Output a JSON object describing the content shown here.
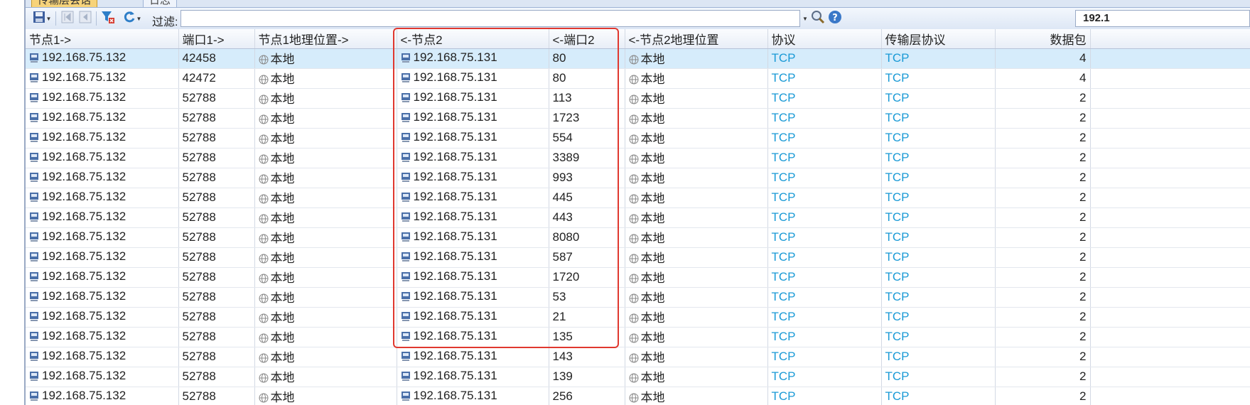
{
  "tabs": [
    {
      "label": "传输层会话",
      "active": true
    },
    {
      "label": "日志",
      "active": false
    }
  ],
  "toolbar": {
    "filter_label": "过滤:",
    "filter_value": "",
    "address_value": "192.1"
  },
  "icons": {
    "save": "save-icon",
    "first": "first-page-icon",
    "prev": "previous-page-icon",
    "filter": "filter-icon",
    "refresh": "refresh-icon",
    "search": "search-icon",
    "help": "help-icon",
    "host": "host-icon",
    "globe": "globe-icon"
  },
  "colors": {
    "link": "#1a9ad6",
    "selection": "#d6ecfb",
    "highlight": "#e0382f",
    "active_tab": "#f7d37a"
  },
  "table": {
    "columns": [
      "节点1->",
      "端口1->",
      "节点1地理位置->",
      "<-节点2",
      "<-端口2",
      "<-节点2地理位置",
      "协议",
      "传输层协议",
      "数据包"
    ],
    "rows": [
      {
        "node1": "192.168.75.132",
        "port1": "42458",
        "geo1": "本地",
        "node2": "192.168.75.131",
        "port2": "80",
        "geo2": "本地",
        "proto": "TCP",
        "transport": "TCP",
        "packets": "4"
      },
      {
        "node1": "192.168.75.132",
        "port1": "42472",
        "geo1": "本地",
        "node2": "192.168.75.131",
        "port2": "80",
        "geo2": "本地",
        "proto": "TCP",
        "transport": "TCP",
        "packets": "4"
      },
      {
        "node1": "192.168.75.132",
        "port1": "52788",
        "geo1": "本地",
        "node2": "192.168.75.131",
        "port2": "113",
        "geo2": "本地",
        "proto": "TCP",
        "transport": "TCP",
        "packets": "2"
      },
      {
        "node1": "192.168.75.132",
        "port1": "52788",
        "geo1": "本地",
        "node2": "192.168.75.131",
        "port2": "1723",
        "geo2": "本地",
        "proto": "TCP",
        "transport": "TCP",
        "packets": "2"
      },
      {
        "node1": "192.168.75.132",
        "port1": "52788",
        "geo1": "本地",
        "node2": "192.168.75.131",
        "port2": "554",
        "geo2": "本地",
        "proto": "TCP",
        "transport": "TCP",
        "packets": "2"
      },
      {
        "node1": "192.168.75.132",
        "port1": "52788",
        "geo1": "本地",
        "node2": "192.168.75.131",
        "port2": "3389",
        "geo2": "本地",
        "proto": "TCP",
        "transport": "TCP",
        "packets": "2"
      },
      {
        "node1": "192.168.75.132",
        "port1": "52788",
        "geo1": "本地",
        "node2": "192.168.75.131",
        "port2": "993",
        "geo2": "本地",
        "proto": "TCP",
        "transport": "TCP",
        "packets": "2"
      },
      {
        "node1": "192.168.75.132",
        "port1": "52788",
        "geo1": "本地",
        "node2": "192.168.75.131",
        "port2": "445",
        "geo2": "本地",
        "proto": "TCP",
        "transport": "TCP",
        "packets": "2"
      },
      {
        "node1": "192.168.75.132",
        "port1": "52788",
        "geo1": "本地",
        "node2": "192.168.75.131",
        "port2": "443",
        "geo2": "本地",
        "proto": "TCP",
        "transport": "TCP",
        "packets": "2"
      },
      {
        "node1": "192.168.75.132",
        "port1": "52788",
        "geo1": "本地",
        "node2": "192.168.75.131",
        "port2": "8080",
        "geo2": "本地",
        "proto": "TCP",
        "transport": "TCP",
        "packets": "2"
      },
      {
        "node1": "192.168.75.132",
        "port1": "52788",
        "geo1": "本地",
        "node2": "192.168.75.131",
        "port2": "587",
        "geo2": "本地",
        "proto": "TCP",
        "transport": "TCP",
        "packets": "2"
      },
      {
        "node1": "192.168.75.132",
        "port1": "52788",
        "geo1": "本地",
        "node2": "192.168.75.131",
        "port2": "1720",
        "geo2": "本地",
        "proto": "TCP",
        "transport": "TCP",
        "packets": "2"
      },
      {
        "node1": "192.168.75.132",
        "port1": "52788",
        "geo1": "本地",
        "node2": "192.168.75.131",
        "port2": "53",
        "geo2": "本地",
        "proto": "TCP",
        "transport": "TCP",
        "packets": "2"
      },
      {
        "node1": "192.168.75.132",
        "port1": "52788",
        "geo1": "本地",
        "node2": "192.168.75.131",
        "port2": "21",
        "geo2": "本地",
        "proto": "TCP",
        "transport": "TCP",
        "packets": "2"
      },
      {
        "node1": "192.168.75.132",
        "port1": "52788",
        "geo1": "本地",
        "node2": "192.168.75.131",
        "port2": "135",
        "geo2": "本地",
        "proto": "TCP",
        "transport": "TCP",
        "packets": "2"
      },
      {
        "node1": "192.168.75.132",
        "port1": "52788",
        "geo1": "本地",
        "node2": "192.168.75.131",
        "port2": "143",
        "geo2": "本地",
        "proto": "TCP",
        "transport": "TCP",
        "packets": "2"
      },
      {
        "node1": "192.168.75.132",
        "port1": "52788",
        "geo1": "本地",
        "node2": "192.168.75.131",
        "port2": "139",
        "geo2": "本地",
        "proto": "TCP",
        "transport": "TCP",
        "packets": "2"
      },
      {
        "node1": "192.168.75.132",
        "port1": "52788",
        "geo1": "本地",
        "node2": "192.168.75.131",
        "port2": "256",
        "geo2": "本地",
        "proto": "TCP",
        "transport": "TCP",
        "packets": "2"
      }
    ]
  }
}
